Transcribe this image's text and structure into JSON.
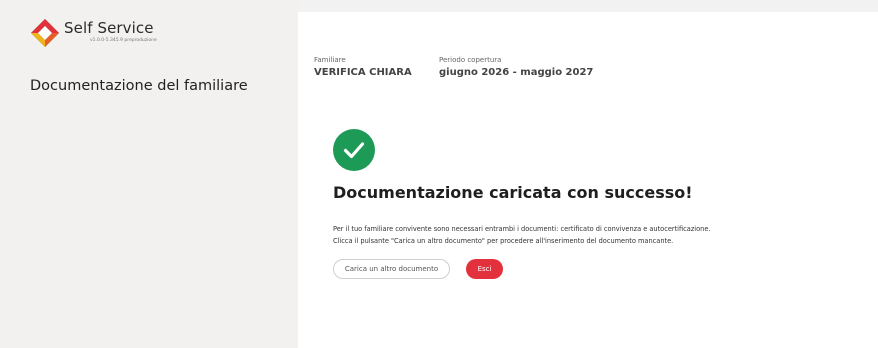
{
  "brand": {
    "name": "Self Service",
    "version": "v1.0.0-5.345.9 preproduzione",
    "logo_icon": "diamond-logo-icon",
    "colors": {
      "red": "#e2313c",
      "green": "#1e9a57",
      "yellow": "#f2b21b",
      "blue": "#2f6fb5"
    }
  },
  "sidebar": {
    "title": "Documentazione del familiare"
  },
  "info": {
    "familiare_label": "Familiare",
    "familiare_value": "VERIFICA CHIARA",
    "periodo_label": "Periodo copertura",
    "periodo_value": "giugno 2026 - maggio 2027"
  },
  "success": {
    "icon": "check-circle-icon",
    "icon_color": "#1e9a57",
    "title": "Documentazione caricata con successo!",
    "message_line1": "Per il tuo familiare convivente sono necessari entrambi i documenti: certificato di convivenza e autocertificazione.",
    "message_line2": "Clicca il pulsante \"Carica un altro documento\" per procedere all'inserimento del documento mancante."
  },
  "actions": {
    "upload_another_label": "Carica un altro documento",
    "exit_label": "Esci",
    "exit_color": "#e2313c"
  }
}
